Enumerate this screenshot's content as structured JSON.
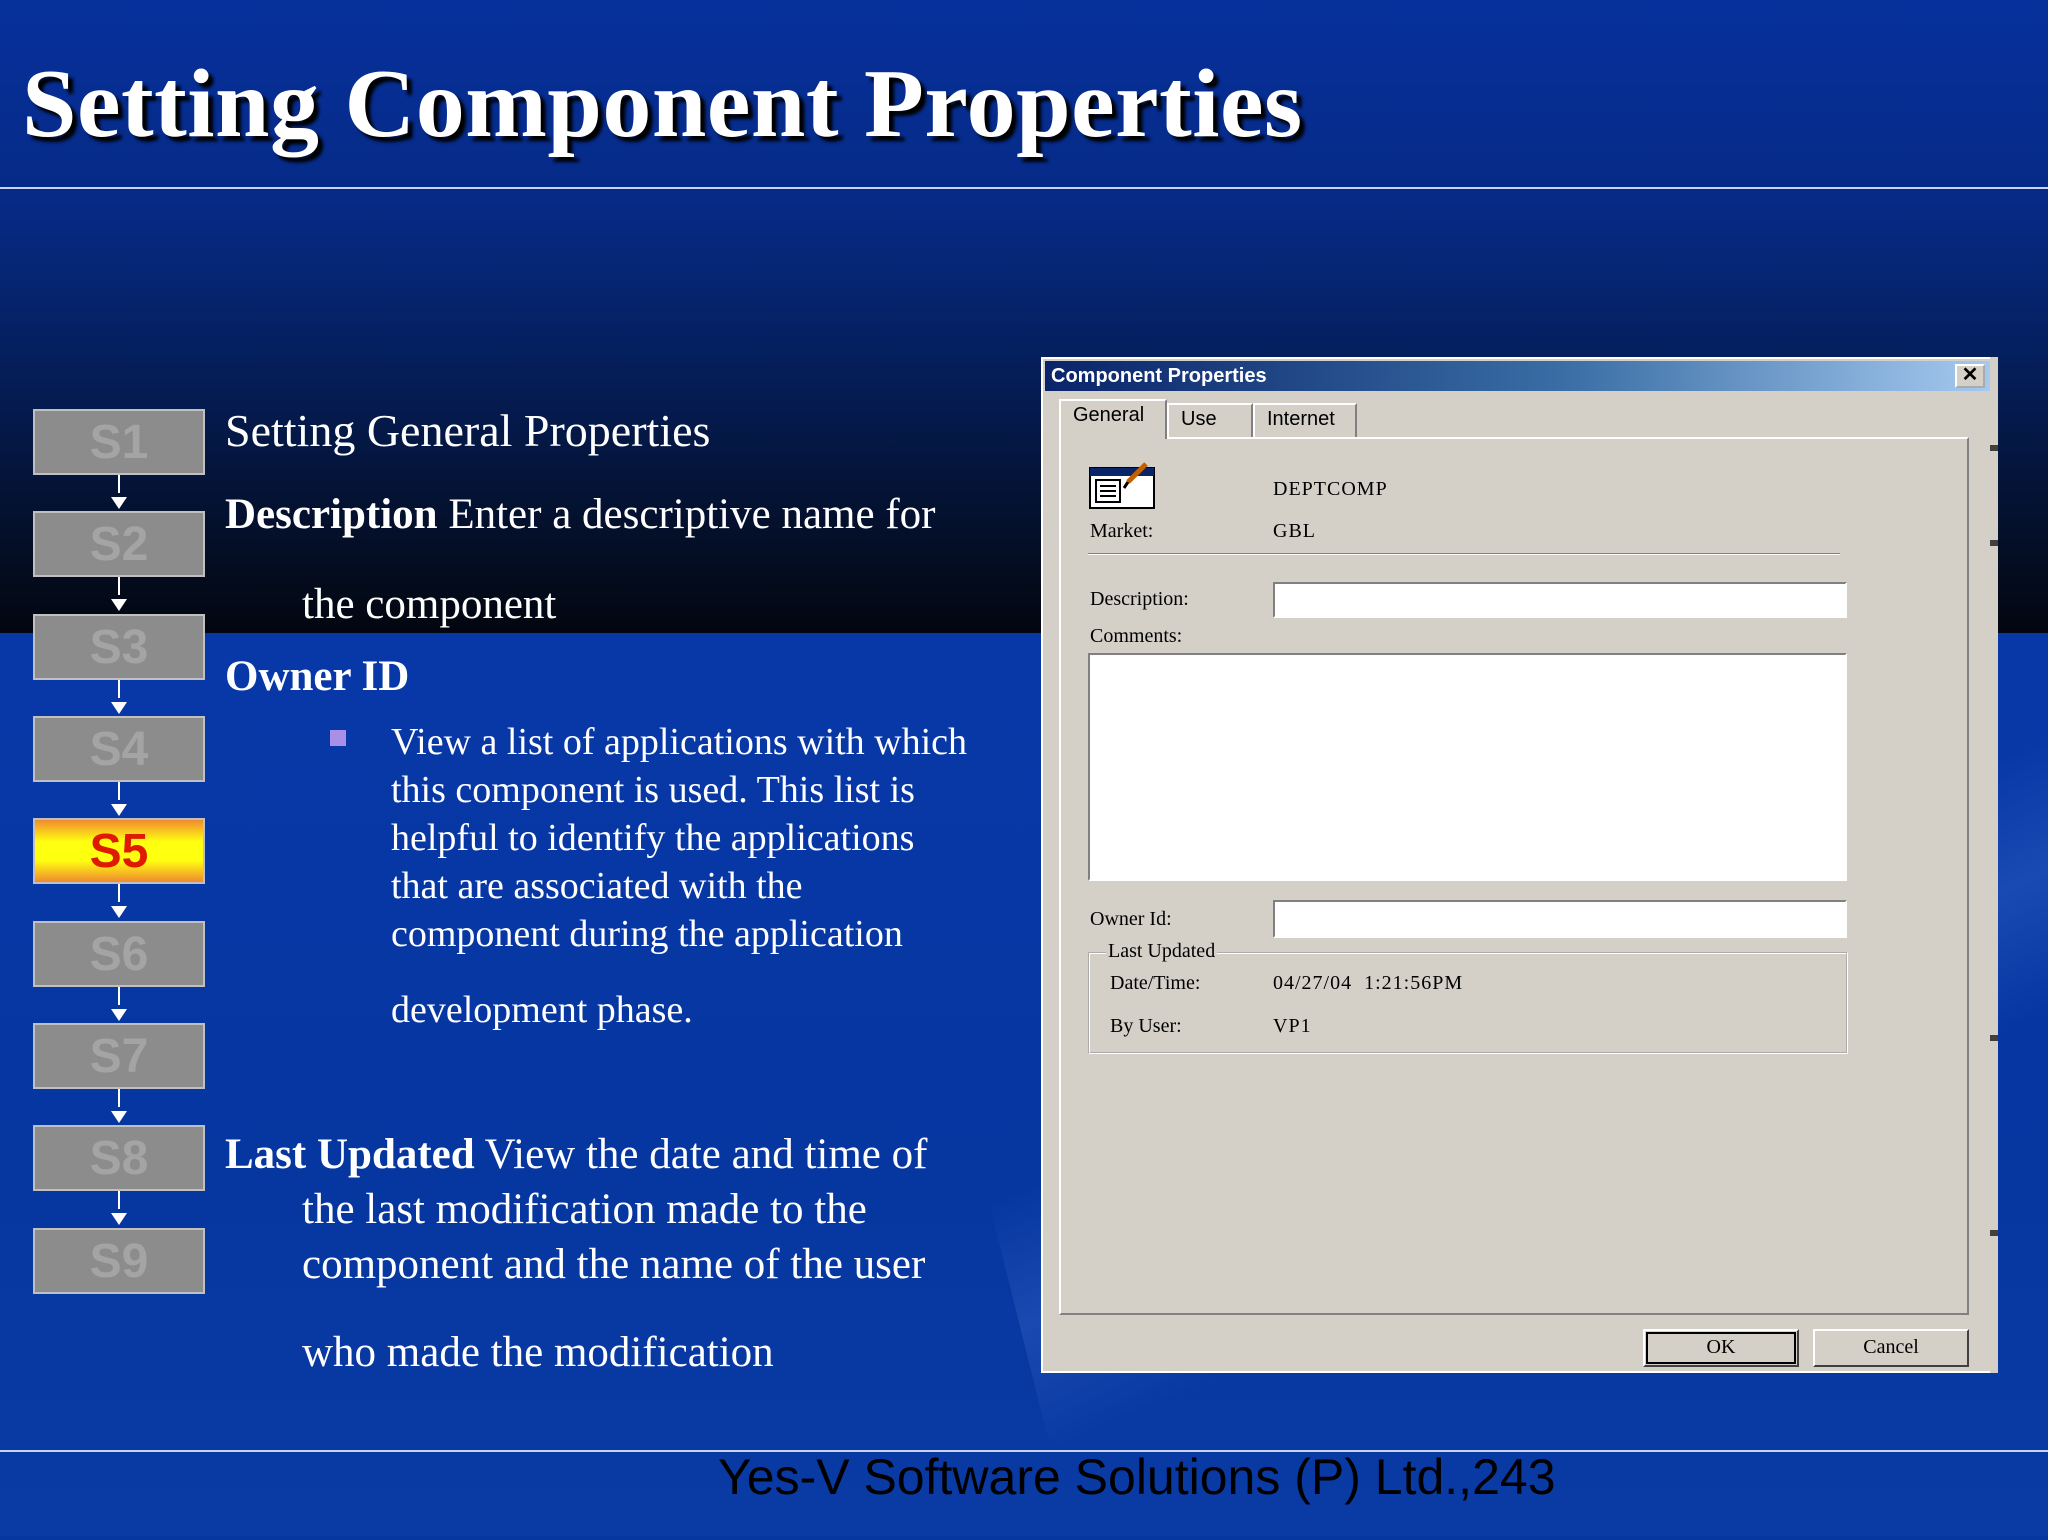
{
  "title": "Setting Component Properties",
  "steps": [
    {
      "label": "S1",
      "active": false
    },
    {
      "label": "S2",
      "active": false
    },
    {
      "label": "S3",
      "active": false
    },
    {
      "label": "S4",
      "active": false
    },
    {
      "label": "S5",
      "active": true
    },
    {
      "label": "S6",
      "active": false
    },
    {
      "label": "S7",
      "active": false
    },
    {
      "label": "S8",
      "active": false
    },
    {
      "label": "S9",
      "active": false
    }
  ],
  "content": {
    "heading": "Setting General Properties",
    "description_term": "Description",
    "description_text_1": " Enter a descriptive name for",
    "description_text_2": "the component",
    "owner_term": "Owner ID",
    "owner_lines": [
      "View a list of applications with which",
      "this component is used. This list is",
      "helpful to identify the applications",
      "that are associated with the",
      "component during the application",
      "development phase."
    ],
    "last_updated_term": "Last Updated",
    "last_updated_text_1": " View the date and time of",
    "last_updated_lines": [
      "the last modification made to the",
      "component and the name of the user",
      "who made the modification"
    ]
  },
  "footer": "Yes-V Software Solutions (P) Ltd.,243",
  "dialog": {
    "title": "Component Properties",
    "close_glyph": "✕",
    "tabs": [
      {
        "label": "General",
        "active": true
      },
      {
        "label": "Use",
        "active": false
      },
      {
        "label": "Internet",
        "active": false
      }
    ],
    "component_name": "DEPTCOMP",
    "market_label": "Market:",
    "market_value": "GBL",
    "description_label": "Description:",
    "description_value": "",
    "comments_label": "Comments:",
    "comments_value": "",
    "owner_label": "Owner Id:",
    "owner_value": "",
    "last_updated_group": "Last Updated",
    "datetime_label": "Date/Time:",
    "datetime_value": "04/27/04  1:21:56PM",
    "byuser_label": "By User:",
    "byuser_value": "VP1",
    "ok_label": "OK",
    "cancel_label": "Cancel"
  },
  "colors": {
    "background_blue": "#0636a0",
    "active_step_text": "#e01a00",
    "active_step_fill": "#ffff10",
    "bullet": "#a890e8",
    "titlebar": "#0a246a"
  }
}
